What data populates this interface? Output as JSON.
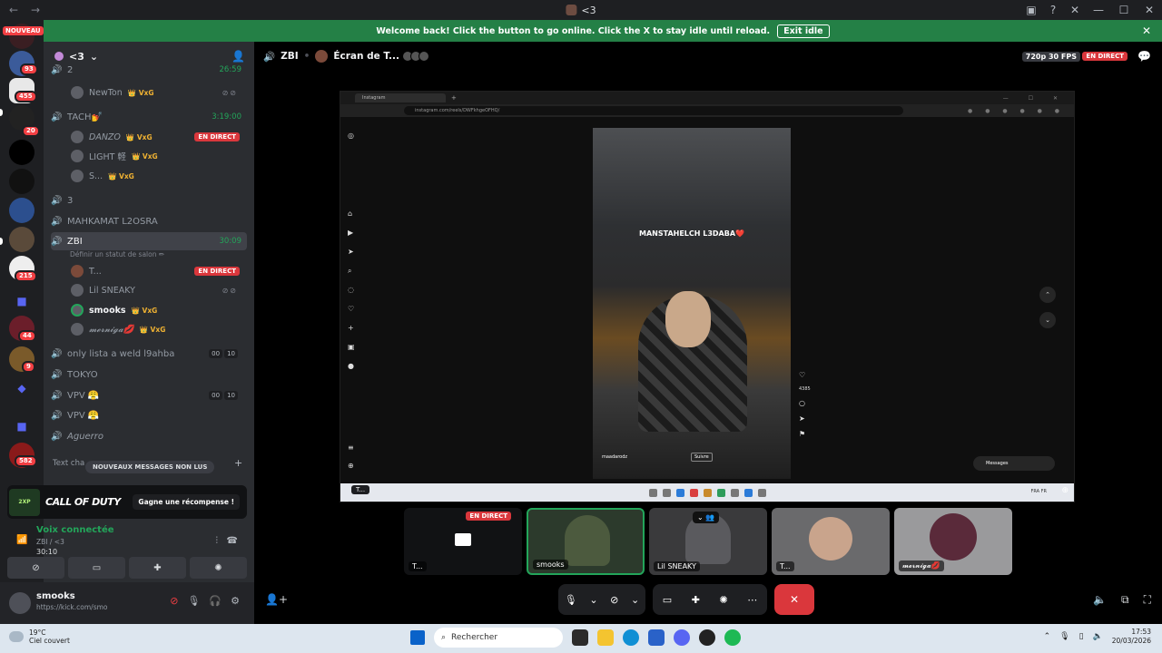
{
  "titlebar": {
    "title": "<3",
    "back": "←",
    "forward": "→"
  },
  "banner": {
    "text": "Welcome back! Click the button to go online. Click the X to stay idle until reload.",
    "exit_label": "Exit idle"
  },
  "guilds": {
    "nouveau": "NOUVEAU",
    "badges": [
      "93",
      "455",
      "20",
      "215",
      "44",
      "9",
      "582"
    ]
  },
  "server": {
    "name": "<3"
  },
  "channels": [
    {
      "name": "2",
      "time": "26:59"
    },
    {
      "name": "TACH💅",
      "time": "3:19:00"
    },
    {
      "name": "3"
    },
    {
      "name": "MAHKAMAT L2OSRA"
    },
    {
      "name": "ZBI",
      "time": "30:09",
      "status": "Définir un statut de salon ✏"
    },
    {
      "name": "only lista a weld l9ahba",
      "counts": [
        "00",
        "10"
      ]
    },
    {
      "name": "TOKYO"
    },
    {
      "name": "VPV 😤",
      "counts": [
        "00",
        "10"
      ]
    },
    {
      "name": "VPV 😤"
    },
    {
      "name": "Aguerro"
    }
  ],
  "users": {
    "newton": "NewTon",
    "danzo": "DANZO",
    "light": "LIGHT 軽",
    "s": "S...",
    "t": "T...",
    "lil": "Lil SNEAKY",
    "smooks": "smooks",
    "merniga": "𝓶𝓮𝓻𝓷𝓲𝓰𝓪💋",
    "tag": "👑 VxG",
    "live": "EN DIRECT"
  },
  "textch": {
    "label": "Text cha",
    "new_messages": "NOUVEAUX MESSAGES NON LUS"
  },
  "promo": {
    "logo": "2XP",
    "title": "CALL OF DUTY",
    "button": "Gagne une récompense !"
  },
  "voice": {
    "status": "Voix connectée",
    "channel": "ZBI / <3",
    "time": "30:10"
  },
  "userbar": {
    "name": "smooks",
    "status": "https://kick.com/smo"
  },
  "stage": {
    "channel": "ZBI",
    "stream_title": "Écran de T...",
    "quality": "720p 30 FPS",
    "live": "EN DIRECT"
  },
  "browser": {
    "tab_title": "Instagram",
    "url": "instagram.com/reels/DWFkhgeOFHQ/",
    "caption": "MANSTAHELCH L3DABA❤️",
    "author": "maadarodz",
    "follow": "Suivre",
    "likes": "4385",
    "messages_label": "Messages",
    "tray_lang": "FRA FR"
  },
  "screen_tag": "T...",
  "tiles": [
    {
      "label": "T...",
      "live": "EN DIRECT"
    },
    {
      "label": "smooks"
    },
    {
      "label": "Lil SNEAKY"
    },
    {
      "label": "T..."
    },
    {
      "label": "𝓶𝓮𝓻𝓷𝓲𝓰𝓪💋"
    }
  ],
  "taskbar": {
    "temp": "19°C",
    "weather": "Ciel couvert",
    "search": "Rechercher",
    "time": "17:53",
    "date": "20/03/2026"
  },
  "colors": {
    "live": "#da373c",
    "online": "#23a55a",
    "banner": "#248046"
  }
}
